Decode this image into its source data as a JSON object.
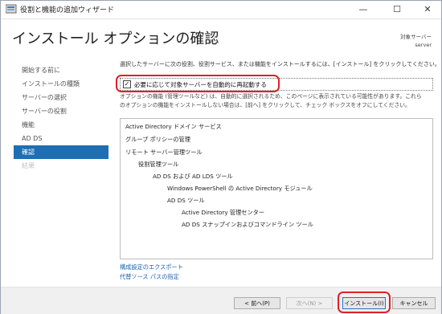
{
  "window": {
    "title": "役割と機能の追加ウィザード",
    "minimize_icon": "minimize-icon",
    "maximize_icon": "maximize-icon",
    "close_icon": "close-icon"
  },
  "header": {
    "title": "インストール オプションの確認",
    "target_label": "対象サーバー",
    "target_value": "server"
  },
  "nav": {
    "items": [
      {
        "label": "開始する前に",
        "state": "normal"
      },
      {
        "label": "インストールの種類",
        "state": "normal"
      },
      {
        "label": "サーバーの選択",
        "state": "normal"
      },
      {
        "label": "サーバーの役割",
        "state": "normal"
      },
      {
        "label": "機能",
        "state": "normal"
      },
      {
        "label": "AD DS",
        "state": "normal"
      },
      {
        "label": "確認",
        "state": "active"
      },
      {
        "label": "結果",
        "state": "disabled"
      }
    ]
  },
  "content": {
    "description": "選択したサーバーに次の役割、役割サービス、または機能をインストールするには、[インストール] をクリックしてください。",
    "restart_checkbox": {
      "label": "必要に応じて対象サーバーを自動的に再起動する",
      "checked": true
    },
    "note_line1": "オプションの機能 (管理ツールなど) は、自動的に選択されるため、このページに表示されている可能性があります。これら",
    "note_line2": "のオプションの機能をインストールしない場合は、[前へ] をクリックして、チェック ボックスをオフにしてください。",
    "features": [
      {
        "label": "Active Directory ドメイン サービス",
        "level": 0
      },
      {
        "label": "グループ ポリシーの管理",
        "level": 0
      },
      {
        "label": "リモート サーバー管理ツール",
        "level": 0
      },
      {
        "label": "役割管理ツール",
        "level": 1
      },
      {
        "label": "AD DS および AD LDS ツール",
        "level": 2
      },
      {
        "label": "Windows PowerShell の Active Directory モジュール",
        "level": 3
      },
      {
        "label": "AD DS ツール",
        "level": 3
      },
      {
        "label": "Active Directory 管理センター",
        "level": 4
      },
      {
        "label": "AD DS スナップインおよびコマンドライン ツール",
        "level": 4
      }
    ],
    "links": {
      "export": "構成設定のエクスポート",
      "alt_source": "代替ソース パスの指定"
    }
  },
  "footer": {
    "prev": "< 前へ(P)",
    "next": "次へ(N) >",
    "install": "インストール(I)",
    "cancel": "キャンセル"
  },
  "colors": {
    "accent": "#1e6eb4",
    "highlight": "#e2202a",
    "link": "#1a62b0"
  }
}
